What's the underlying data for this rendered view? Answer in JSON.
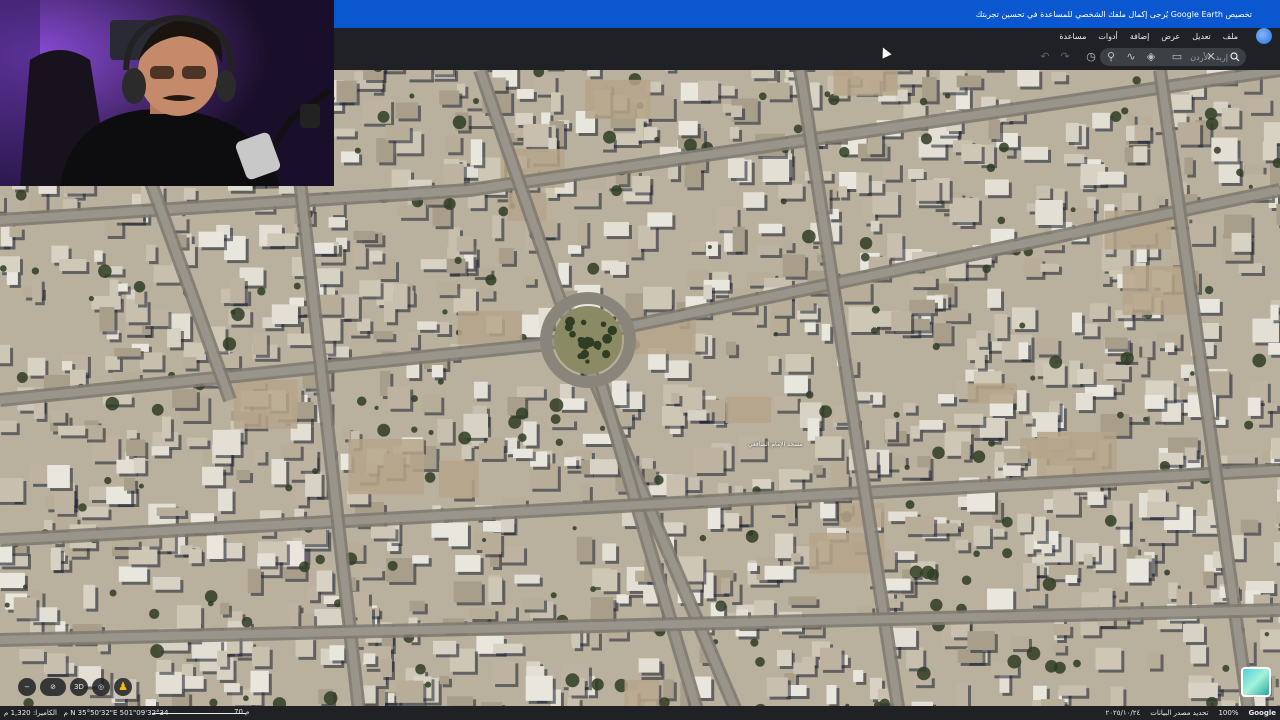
{
  "banner": {
    "brand": "Google Earth",
    "message": "تخصيص Google Earth يُرجى إكمال ملفك الشخصي للمساعدة في تحسين تجربتك"
  },
  "menu": {
    "items": [
      "ملف",
      "تعديل",
      "عرض",
      "إضافة",
      "أدوات",
      "مساعدة"
    ]
  },
  "search": {
    "placeholder": "إربد، الأردن"
  },
  "toolbar": {
    "icons": [
      "undo-icon",
      "redo-icon",
      "history-icon",
      "placemark-icon",
      "path-icon",
      "layers-icon",
      "ruler-icon",
      "close-tour-icon"
    ]
  },
  "map": {
    "place_label": "مسجد الإمام الشافعي"
  },
  "controls": {
    "mode_3d": "3D"
  },
  "status": {
    "coords": "32°34'09\"N 35°50'32\"E 501 م",
    "camera": "الكاميرا: 1,320 م",
    "scale": "70 م",
    "google": "Google",
    "zoom": "100%",
    "data_source": "تحديد مصدر البيانات",
    "date": "٢٠٢٥/١٠/٢٤"
  },
  "colors": {
    "banner": "#0b57d0",
    "chrome": "#202124",
    "map_base": "#b9b09e"
  }
}
